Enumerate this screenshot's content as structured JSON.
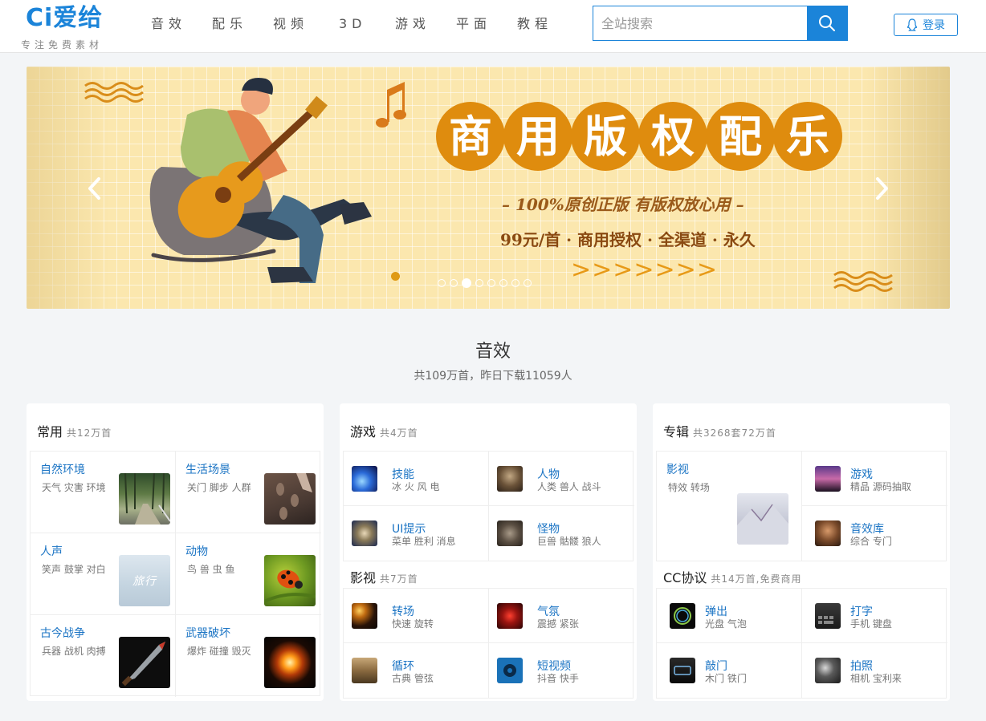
{
  "header": {
    "logo_text": "Ci爱给",
    "logo_slogan": "专注免费素材",
    "nav": [
      "音效",
      "配乐",
      "视频",
      "3D",
      "游戏",
      "平面",
      "教程"
    ],
    "search_placeholder": "全站搜索",
    "login_label": "登录"
  },
  "banner": {
    "title_chars": [
      "商",
      "用",
      "版",
      "权",
      "配",
      "乐"
    ],
    "subtitle": "– 100%原创正版 有版权放心用 –",
    "tagline": "99元/首 · 商用授权 · 全渠道 · 永久",
    "arrows": ">>>>>>>",
    "slide_count": 8,
    "active_slide": 3
  },
  "section": {
    "title": "音效",
    "stat": "共109万首，昨日下载11059人"
  },
  "cards": {
    "common": {
      "title": "常用",
      "count": "共12万首",
      "items": [
        {
          "name": "自然环境",
          "tags": "天气 灾害 环境"
        },
        {
          "name": "生活场景",
          "tags": "关门 脚步 人群"
        },
        {
          "name": "人声",
          "tags": "笑声 鼓掌 对白"
        },
        {
          "name": "动物",
          "tags": "鸟 兽 虫 鱼"
        },
        {
          "name": "古今战争",
          "tags": "兵器 战机 肉搏"
        },
        {
          "name": "武器破坏",
          "tags": "爆炸 碰撞 毁灭"
        }
      ],
      "voice_thumb_text": "旅行"
    },
    "game": {
      "title": "游戏",
      "count": "共4万首",
      "items": [
        {
          "name": "技能",
          "tags": "冰 火 风 电"
        },
        {
          "name": "人物",
          "tags": "人类 兽人 战斗"
        },
        {
          "name": "UI提示",
          "tags": "菜单 胜利 消息"
        },
        {
          "name": "怪物",
          "tags": "巨兽 骷髅 狼人"
        }
      ]
    },
    "film": {
      "title": "影视",
      "count": "共7万首",
      "items": [
        {
          "name": "转场",
          "tags": "快速 旋转"
        },
        {
          "name": "气氛",
          "tags": "震撼 紧张"
        },
        {
          "name": "循环",
          "tags": "古典 管弦"
        },
        {
          "name": "短视频",
          "tags": "抖音 快手"
        }
      ]
    },
    "album": {
      "title": "专辑",
      "count": "共3268套72万首",
      "items": [
        {
          "name": "影视",
          "tags": "特效 转场"
        },
        {
          "name": "游戏",
          "tags": "精品 源码抽取"
        },
        {
          "name": "音效库",
          "tags": "综合 专门"
        }
      ]
    },
    "cc": {
      "title": "CC协议",
      "count": "共14万首,免费商用",
      "items": [
        {
          "name": "弹出",
          "tags": "光盘 气泡"
        },
        {
          "name": "打字",
          "tags": "手机 键盘"
        },
        {
          "name": "敲门",
          "tags": "木门 铁门"
        },
        {
          "name": "拍照",
          "tags": "相机 宝利来"
        }
      ]
    }
  },
  "colors": {
    "brand": "#1b84d9",
    "banner_accent": "#df8c0e"
  }
}
